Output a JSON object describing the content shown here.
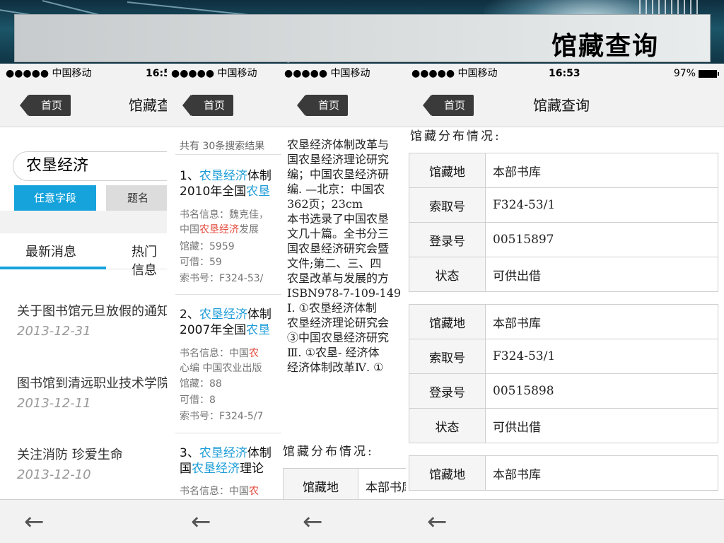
{
  "banner": {
    "title": "馆藏查询"
  },
  "status": {
    "carrier": "●●●●● 中国移动 ",
    "wifi": "wifi-icon",
    "time": "16:53",
    "battery": "97%"
  },
  "nav": {
    "back": "首页",
    "title": "馆藏查询"
  },
  "screen1": {
    "search_value": "农垦经济",
    "chips": [
      "任意字段",
      "题名"
    ],
    "tabs": [
      "最新消息",
      "热门信息"
    ],
    "news": [
      {
        "title": "关于图书馆元旦放假的通知",
        "date": "2013-12-31"
      },
      {
        "title": "图书馆到清远职业技术学院",
        "date": "2013-12-11"
      },
      {
        "title": "关注消防 珍爱生命",
        "date": "2013-12-10"
      }
    ]
  },
  "screen2": {
    "summary": "共有 30条搜索结果",
    "results": [
      {
        "num": "1、",
        "t1": "农垦经济",
        "t1b": "体制",
        "t2a": "2010年全国",
        "t2b": "农垦",
        "m1": "书名信息：魏克佳，",
        "m2a": "中国",
        "m2b": "农垦经济",
        "m2c": "发展",
        "holdings": "馆藏：5959",
        "available": "可借：59",
        "callno": "索书号：F324-53/"
      },
      {
        "num": "2、",
        "t1": "农垦经济",
        "t1b": "体制",
        "t2a": "2007年全国",
        "t2b": "农垦",
        "m1a": "书名信息：中国",
        "m1b": "农",
        "m2": "心编 中国农业出版",
        "holdings": "馆藏：88",
        "available": "可借：8",
        "callno": "索书号：F324-5/7"
      },
      {
        "num": "3、",
        "t1": "农垦经济",
        "t1b": "体制",
        "t2a": "国",
        "t2b": "农垦经济",
        "t2c": "理论",
        "m1a": "书名信息：中国",
        "m1b": "农"
      }
    ]
  },
  "screen3": {
    "lines": [
      "农垦经济体制改革与",
      "国农垦经济理论研究",
      "编；中国农垦经济研",
      "编. —北京：中国农",
      "362页；23cm",
      "本书选录了中国农垦",
      "文几十篇。全书分三",
      "国农垦经济研究会暨",
      "文件;第二、三、四",
      "农垦改革与发展的方",
      "ISBN978-7-109-149",
      "Ⅰ. ①农垦经济体制",
      "农垦经济理论研究会",
      "③中国农垦经济研究",
      "Ⅲ. ①农垦- 经济体",
      "经济体制改革Ⅳ. ①"
    ],
    "dist_label": "馆藏分布情况:",
    "table_key": "馆藏地",
    "table_val": "本部书库"
  },
  "screen4": {
    "dist_label": "馆藏分布情况:",
    "tables": [
      [
        {
          "k": "馆藏地",
          "v": "本部书库"
        },
        {
          "k": "索取号",
          "v": "F324-53/1"
        },
        {
          "k": "登录号",
          "v": "00515897"
        },
        {
          "k": "状态",
          "v": "可供出借"
        }
      ],
      [
        {
          "k": "馆藏地",
          "v": "本部书库"
        },
        {
          "k": "索取号",
          "v": "F324-53/1"
        },
        {
          "k": "登录号",
          "v": "00515898"
        },
        {
          "k": "状态",
          "v": "可供出借"
        }
      ],
      [
        {
          "k": "馆藏地",
          "v": "本部书库"
        }
      ]
    ]
  },
  "bottom": {
    "back_icon": "back-arrow-icon"
  }
}
